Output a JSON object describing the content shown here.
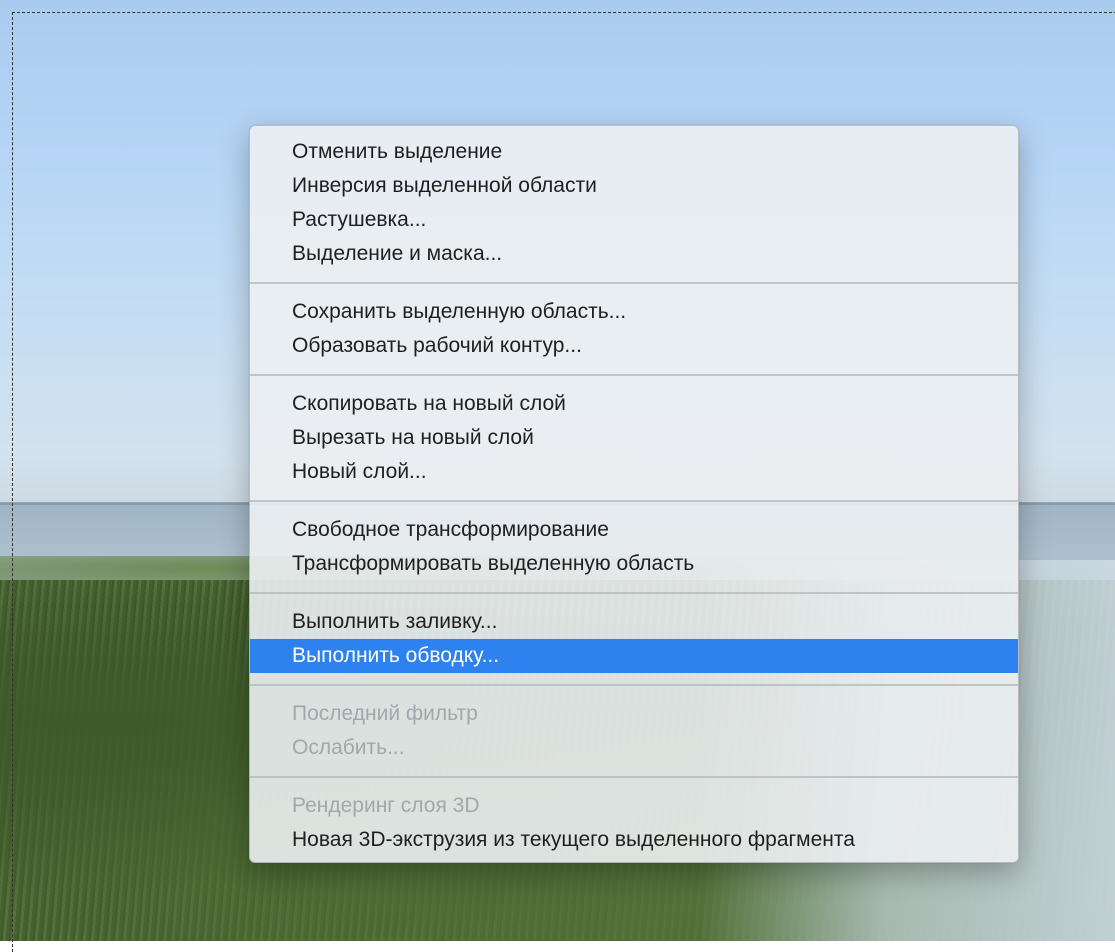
{
  "menu": {
    "groups": [
      {
        "items": [
          {
            "label": "Отменить выделение",
            "state": "normal"
          },
          {
            "label": "Инверсия выделенной области",
            "state": "normal"
          },
          {
            "label": "Растушевка...",
            "state": "normal"
          },
          {
            "label": "Выделение и маска...",
            "state": "normal"
          }
        ]
      },
      {
        "items": [
          {
            "label": "Сохранить выделенную область...",
            "state": "normal"
          },
          {
            "label": "Образовать рабочий контур...",
            "state": "normal"
          }
        ]
      },
      {
        "items": [
          {
            "label": "Скопировать на новый слой",
            "state": "normal"
          },
          {
            "label": "Вырезать на новый слой",
            "state": "normal"
          },
          {
            "label": "Новый слой...",
            "state": "normal"
          }
        ]
      },
      {
        "items": [
          {
            "label": "Свободное трансформирование",
            "state": "normal"
          },
          {
            "label": "Трансформировать выделенную область",
            "state": "normal"
          }
        ]
      },
      {
        "items": [
          {
            "label": "Выполнить заливку...",
            "state": "normal"
          },
          {
            "label": "Выполнить обводку...",
            "state": "selected"
          }
        ]
      },
      {
        "items": [
          {
            "label": "Последний фильтр",
            "state": "disabled"
          },
          {
            "label": "Ослабить...",
            "state": "disabled"
          }
        ]
      },
      {
        "items": [
          {
            "label": "Рендеринг слоя 3D",
            "state": "disabled"
          },
          {
            "label": "Новая 3D-экструзия из текущего выделенного фрагмента",
            "state": "normal"
          }
        ]
      }
    ]
  },
  "colors": {
    "selected_bg": "#2e82f0",
    "disabled_text": "#a2a7ab",
    "text": "#1f1f1f"
  }
}
